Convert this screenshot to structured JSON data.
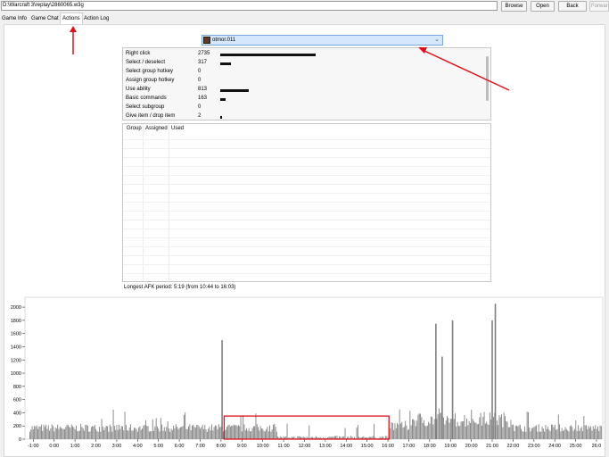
{
  "toolbar": {
    "path_value": "D:\\Warcraft 3\\replay\\2860065.w3g",
    "browse_label": "Browse",
    "open_label": "Open",
    "back_label": "Back",
    "forward_label": "Forward"
  },
  "tabs": [
    {
      "label": "Game Info",
      "active": false
    },
    {
      "label": "Game Chat",
      "active": false
    },
    {
      "label": "Actions",
      "active": true
    },
    {
      "label": "Action Log",
      "active": false
    }
  ],
  "player_select": {
    "value": "otmor.011"
  },
  "action_stats": [
    {
      "name": "Right click",
      "value": 2735
    },
    {
      "name": "Select / deselect",
      "value": 317
    },
    {
      "name": "Select group hotkey",
      "value": 0
    },
    {
      "name": "Assign group hotkey",
      "value": 0
    },
    {
      "name": "Use ability",
      "value": 813
    },
    {
      "name": "Basic commands",
      "value": 163
    },
    {
      "name": "Select subgroup",
      "value": 0
    },
    {
      "name": "Give item / drop item",
      "value": 2
    }
  ],
  "group_table": {
    "columns": [
      "Group",
      "Assigned",
      "Used"
    ]
  },
  "afk_text": "Longest AFK period: 5:19 (from 10:44 to 16:03)",
  "chart_data": {
    "type": "bar",
    "y_ticks": [
      "2000",
      "1800",
      "1600",
      "1400",
      "1200",
      "1000",
      "800",
      "600",
      "400",
      "200",
      "0"
    ],
    "x_ticks": [
      "-1:00",
      "0:00",
      "1:00",
      "2:00",
      "3:00",
      "4:00",
      "5:00",
      "6:00",
      "7:00",
      "8:00",
      "9:00",
      "10:00",
      "11:00",
      "12:00",
      "13:00",
      "14:00",
      "15:00",
      "16:00",
      "17:00",
      "18:00",
      "19:00",
      "20:00",
      "21:00",
      "22:00",
      "23:00",
      "24:00",
      "25:00",
      "26:0"
    ],
    "xlim": [
      -1.4,
      26.3
    ],
    "ylim": [
      0,
      2150
    ],
    "bar_color": "#7f7f7f",
    "highlight_color": "#e0101a",
    "spikes": [
      {
        "t": 8.05,
        "v": 1500
      },
      {
        "t": 18.3,
        "v": 1750
      },
      {
        "t": 18.6,
        "v": 1250
      },
      {
        "t": 19.1,
        "v": 1800
      },
      {
        "t": 21.0,
        "v": 1800
      },
      {
        "t": 21.15,
        "v": 2050
      }
    ]
  }
}
